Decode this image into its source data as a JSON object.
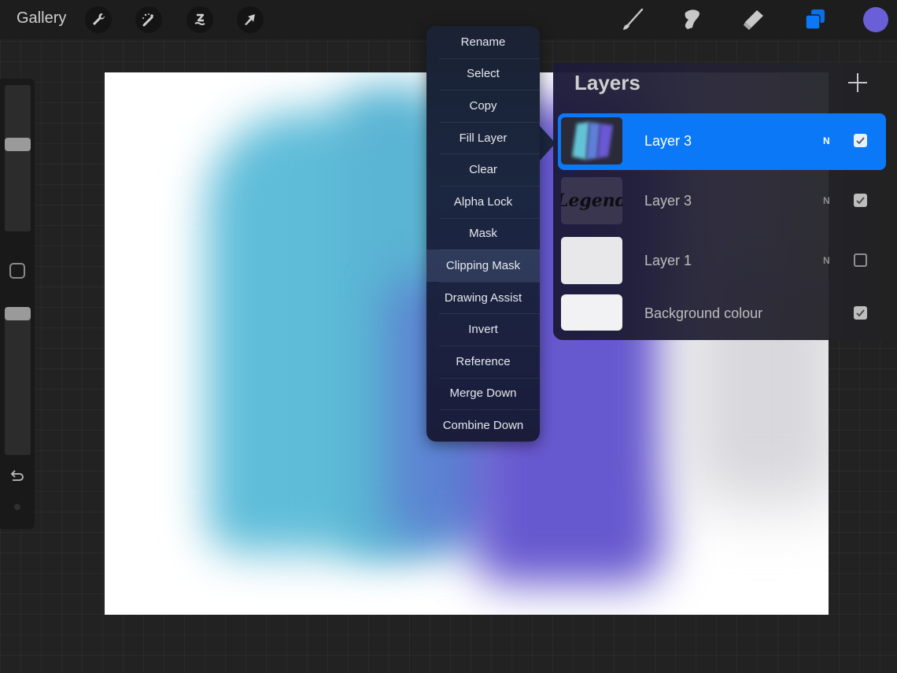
{
  "toolbar": {
    "gallery_label": "Gallery",
    "left_tools": [
      {
        "name": "actions",
        "icon": "wrench-icon"
      },
      {
        "name": "adjustments",
        "icon": "magic-wand-icon"
      },
      {
        "name": "selection",
        "icon": "selection-s-icon"
      },
      {
        "name": "transform",
        "icon": "arrow-cursor-icon"
      }
    ],
    "right_tools": [
      {
        "name": "brush",
        "icon": "brush-icon"
      },
      {
        "name": "smudge",
        "icon": "smudge-finger-icon"
      },
      {
        "name": "eraser",
        "icon": "eraser-icon"
      },
      {
        "name": "layers",
        "icon": "layers-icon",
        "active": true
      }
    ],
    "current_color": "#6a5fd6",
    "accent_color": "#0a78f7"
  },
  "sidebar": {
    "brush_size_level": 0.4,
    "opacity_level": 0.0,
    "modify_icon": "square-icon",
    "undo_icon": "undo-icon",
    "redo_icon": "redo-icon"
  },
  "context_menu": {
    "items": [
      {
        "label": "Rename"
      },
      {
        "label": "Select"
      },
      {
        "label": "Copy"
      },
      {
        "label": "Fill Layer"
      },
      {
        "label": "Clear"
      },
      {
        "label": "Alpha Lock"
      },
      {
        "label": "Mask"
      },
      {
        "label": "Clipping Mask",
        "highlighted": true
      },
      {
        "label": "Drawing Assist"
      },
      {
        "label": "Invert"
      },
      {
        "label": "Reference"
      },
      {
        "label": "Merge Down"
      },
      {
        "label": "Combine Down"
      }
    ]
  },
  "layers_panel": {
    "title": "Layers",
    "add_icon": "plus-icon",
    "layers": [
      {
        "name": "Layer 3",
        "blend_mode": "N",
        "visible": true,
        "selected": true,
        "thumbnail": "blue-purple-strokes"
      },
      {
        "name": "Layer 3",
        "blend_mode": "N",
        "visible": true,
        "selected": false,
        "thumbnail": "legend-lettering",
        "thumbnail_text": "Legend"
      },
      {
        "name": "Layer 1",
        "blend_mode": "N",
        "visible": false,
        "selected": false,
        "thumbnail": "blank"
      },
      {
        "name": "Background colour",
        "blend_mode": "",
        "visible": true,
        "selected": false,
        "thumbnail": "white"
      }
    ]
  }
}
